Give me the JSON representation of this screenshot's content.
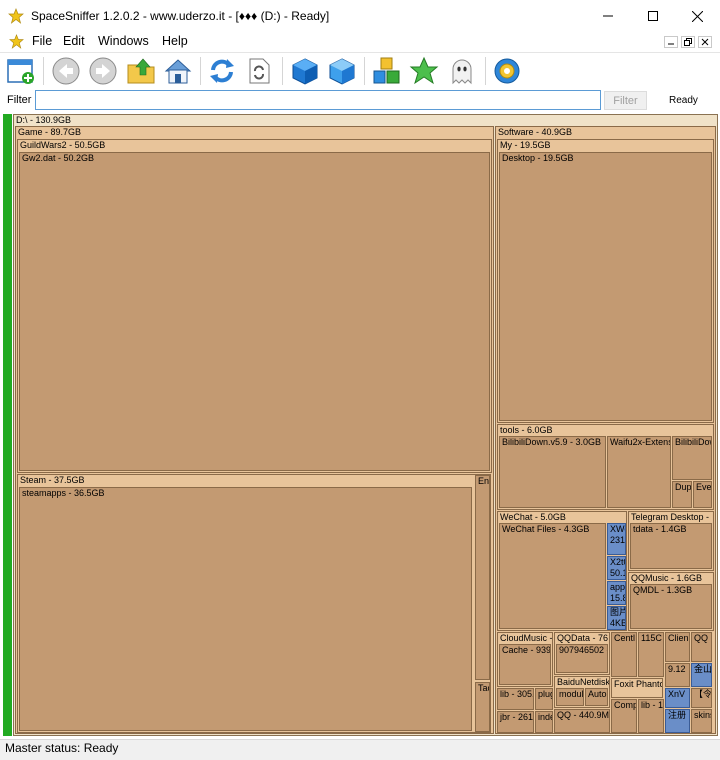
{
  "window": {
    "title": "SpaceSniffer 1.2.0.2 - www.uderzo.it - [♦♦♦ (D:) - Ready]"
  },
  "menu": {
    "items": [
      "File",
      "Edit",
      "Windows",
      "Help"
    ]
  },
  "toolbar": {
    "icons": [
      "new-window-icon",
      "back-icon",
      "forward-icon",
      "up-folder-icon",
      "home-icon",
      "refresh-icon",
      "refresh-document-icon",
      "blue-cube-icon",
      "blue-cube-outline-icon",
      "colored-cubes-icon",
      "star-icon",
      "ghost-icon",
      "settings-icon"
    ]
  },
  "filter": {
    "label": "Filter",
    "value": "",
    "button_label": "Filter",
    "status": "Ready"
  },
  "treemap": {
    "root": "D:\\ - 130.9GB",
    "game": "Game - 89.7GB",
    "guildwars2": "GuildWars2 - 50.5GB",
    "gw2dat": "Gw2.dat - 50.2GB",
    "steam": "Steam - 37.5GB",
    "steamapps": "steamapps - 36.5GB",
    "end": "End",
    "tac": "Tac",
    "software": "Software - 40.9GB",
    "my": "My - 19.5GB",
    "desktop": "Desktop - 19.5GB",
    "tools": "tools - 6.0GB",
    "bilibilidown": "BilibiliDown.v5.9 - 3.0GB",
    "waifu2x": "Waifu2x-Extensi",
    "bilibilidow2": "BilibiliDow",
    "dupl": "Dupl",
    "eve": "Eve",
    "wechat": "WeChat - 5.0GB",
    "wechatfiles": "WeChat Files - 4.3GB",
    "xwe": "XWe 231",
    "x2t": "X2t0 50.1",
    "app": "app 15.8",
    "img": "图片 4KB",
    "telegram": "Telegram Desktop -",
    "tdata": "tdata - 1.4GB",
    "qqmusic": "QQMusic - 1.6GB",
    "qmdl": "QMDL - 1.3GB",
    "cloudmusic": "CloudMusic -",
    "cache": "Cache - 939.",
    "qqdata": "QQData - 76",
    "qqdata_num": "907946502 -",
    "centl": "Centl",
    "c115": "115C",
    "clien": "Clien",
    "qq": "QQ",
    "n912": "9.12",
    "jinshan": "金山",
    "baidunetdisk": "BaiduNetdisk",
    "modul": "modul",
    "auto": "Auto",
    "foxit": "Foxit Phanto",
    "xnv": "XnV",
    "ling": "【令",
    "lib305": "lib - 305.",
    "plug": "plug",
    "comp": "Comp",
    "lib1": "lib - 1",
    "fazhu": "注册",
    "skins": "skins",
    "jbr": "jbr - 261",
    "inde": "inde",
    "qq440": "QQ - 440.9M"
  },
  "status": {
    "text": "Master status: Ready"
  }
}
